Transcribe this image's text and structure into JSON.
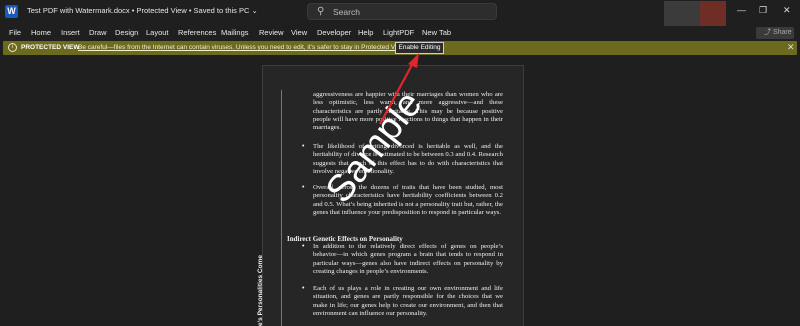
{
  "titlebar": {
    "app_logo": "W",
    "doc_title": "Test PDF with Watermark.docx  •  Protected View  •  Saved to this PC  ⌄",
    "search_placeholder": "Search",
    "min_glyph": "—",
    "max_glyph": "❐",
    "close_glyph": "✕"
  },
  "menu": {
    "items": [
      "File",
      "Home",
      "Insert",
      "Draw",
      "Design",
      "Layout",
      "References",
      "Mailings",
      "Review",
      "View",
      "Developer",
      "Help",
      "LightPDF",
      "New Tab"
    ],
    "share_label": "⤴ Share ⌄"
  },
  "protected_view": {
    "icon": "i",
    "label": "PROTECTED VIEW",
    "message": "Be careful—files from the Internet can contain viruses. Unless you need to edit, it’s safer to stay in Protected View.",
    "button": "Enable Editing",
    "close": "✕",
    "accent_color": "#6c6a1e"
  },
  "document": {
    "side_text": "e’s Personalities Come",
    "para1": "aggressiveness are happier with their marriages than women who are less optimistic, less warm, and more aggressive—and these characteristics are partly heritable. This may be because positive people will have more positive reactions to things that happen in their marriages.",
    "bullet": "•",
    "para2": "The likelihood of getting divorced is heritable as well, and the heritability of divorce is estimated to be between 0.3 and 0.4. Research suggests that much of this effect has to do with characteristics that involve negative emotionality.",
    "para3": "Overall, across the dozens of traits that have been studied, most personality characteristics have heritability coefficients between 0.2 and 0.5. What’s being inherited is not a personality trait but, rather, the genes that influence your predisposition to respond in particular ways.",
    "heading": "Indirect Genetic Effects on Personality",
    "para4": "In addition to the relatively direct effects of genes on people’s behavior—in which genes program a brain that tends to respond in particular ways—genes also have indirect effects on personality by creating changes in people’s environments.",
    "para5": "Each of us plays a role in creating our own environment and life situation, and genes are partly responsible for the choices that we make in life; our genes help to create our environment, and then that environment can influence our personality.",
    "watermark": "Sample"
  },
  "annotation": {
    "arrow_color": "#e0262b"
  }
}
